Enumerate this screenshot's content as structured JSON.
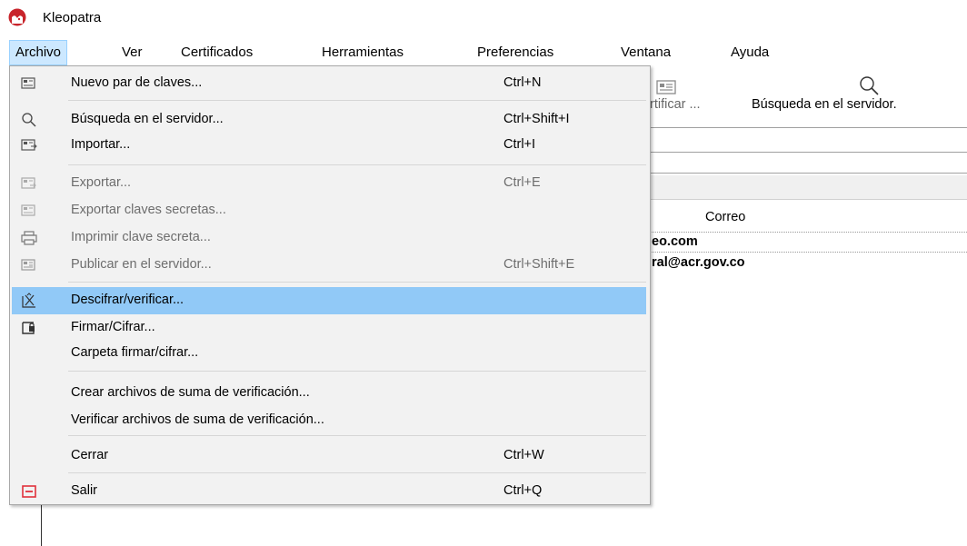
{
  "window": {
    "title": "Kleopatra"
  },
  "menubar": [
    {
      "label": "Archivo",
      "active": true
    },
    {
      "label": "Ver"
    },
    {
      "label": "Certificados"
    },
    {
      "label": "Herramientas"
    },
    {
      "label": "Preferencias"
    },
    {
      "label": "Ventana"
    },
    {
      "label": "Ayuda"
    }
  ],
  "toolbar": {
    "certify_label": "rtificar ...",
    "search_server_label": "Búsqueda en el servidor."
  },
  "table": {
    "column_email": "Correo",
    "rows": [
      {
        "email": "eo.com"
      },
      {
        "email": "ral@acr.gov.co"
      }
    ]
  },
  "archivo_menu": {
    "items": [
      {
        "label": "Nuevo par de claves...",
        "shortcut": "Ctrl+N",
        "icon": "new-keypair-icon",
        "enabled": true
      },
      {
        "label": "Búsqueda en el servidor...",
        "shortcut": "Ctrl+Shift+I",
        "icon": "search-icon",
        "enabled": true
      },
      {
        "label": "Importar...",
        "shortcut": "Ctrl+I",
        "icon": "import-icon",
        "enabled": true
      },
      {
        "label": "Exportar...",
        "shortcut": "Ctrl+E",
        "icon": "export-icon",
        "enabled": false
      },
      {
        "label": "Exportar claves secretas...",
        "shortcut": "",
        "icon": "export-secret-icon",
        "enabled": false
      },
      {
        "label": "Imprimir clave secreta...",
        "shortcut": "",
        "icon": "printer-icon",
        "enabled": false
      },
      {
        "label": "Publicar en el servidor...",
        "shortcut": "Ctrl+Shift+E",
        "icon": "publish-icon",
        "enabled": false
      },
      {
        "label": "Descifrar/verificar...",
        "shortcut": "",
        "icon": "decrypt-verify-icon",
        "enabled": true,
        "highlighted": true
      },
      {
        "label": "Firmar/Cifrar...",
        "shortcut": "",
        "icon": "sign-encrypt-icon",
        "enabled": true
      },
      {
        "label": "Carpeta firmar/cifrar...",
        "shortcut": "",
        "icon": "",
        "enabled": true
      },
      {
        "label": "Crear archivos de suma de verificación...",
        "shortcut": "",
        "icon": "",
        "enabled": true
      },
      {
        "label": "Verificar archivos de suma de verificación...",
        "shortcut": "",
        "icon": "",
        "enabled": true
      },
      {
        "label": "Cerrar",
        "shortcut": "Ctrl+W",
        "icon": "",
        "enabled": true
      },
      {
        "label": "Salir",
        "shortcut": "Ctrl+Q",
        "icon": "quit-icon",
        "enabled": true
      }
    ]
  },
  "colors": {
    "highlight": "#91c9f7",
    "menubar_active": "#cce8ff",
    "disabled_text": "#6d6d6d",
    "quit_icon": "#e0313c"
  }
}
